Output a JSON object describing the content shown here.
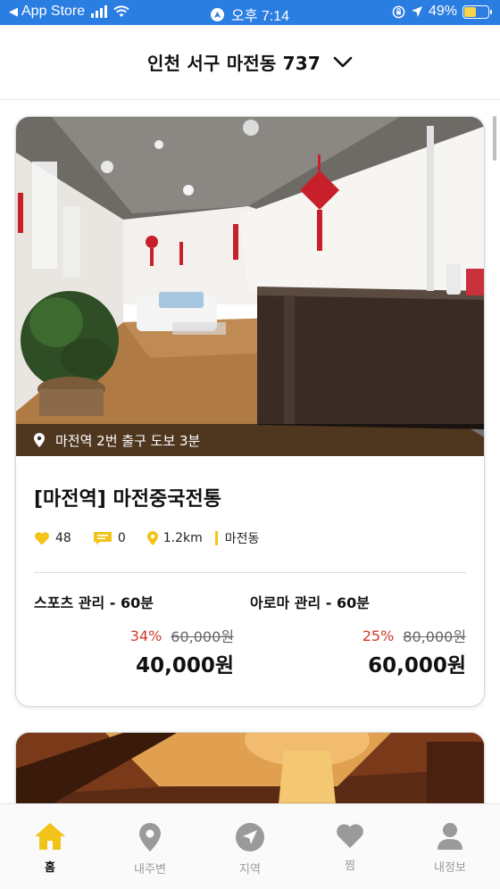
{
  "status_bar": {
    "back_app": "App Store",
    "time": "오후 7:14",
    "battery": "49%",
    "battery_level": 0.49
  },
  "header": {
    "location": "인천 서구 마전동 737"
  },
  "listings": [
    {
      "location_note": "마전역 2번 출구 도보 3분",
      "name": "[마전역] 마전중국전통",
      "likes": "48",
      "reviews": "0",
      "distance": "1.2km",
      "area": "마전동",
      "prices": [
        {
          "name": "스포츠 관리 - 60분",
          "discount": "34%",
          "original": "60,000원",
          "final": "40,000원"
        },
        {
          "name": "아로마 관리 - 60분",
          "discount": "25%",
          "original": "80,000원",
          "final": "60,000원"
        }
      ]
    }
  ],
  "tabs": [
    {
      "label": "홈",
      "icon": "home-icon",
      "active": true
    },
    {
      "label": "내주변",
      "icon": "map-pin-icon",
      "active": false
    },
    {
      "label": "지역",
      "icon": "navigation-icon",
      "active": false
    },
    {
      "label": "찜",
      "icon": "heart-icon",
      "active": false
    },
    {
      "label": "내정보",
      "icon": "person-icon",
      "active": false
    }
  ],
  "colors": {
    "status_bar": "#2a7de1",
    "accent": "#f2c318",
    "discount": "#d03a2a",
    "tab_inactive": "#9a9a9a"
  }
}
